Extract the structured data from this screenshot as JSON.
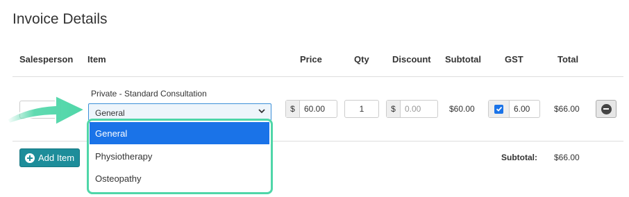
{
  "page": {
    "title": "Invoice Details"
  },
  "table": {
    "headers": {
      "salesperson": "Salesperson",
      "item": "Item",
      "price": "Price",
      "qty": "Qty",
      "discount": "Discount",
      "subtotal": "Subtotal",
      "gst": "GST",
      "total": "Total"
    },
    "row": {
      "item_name": "Private - Standard Consultation",
      "item_category": "General",
      "price_prefix": "$",
      "price": "60.00",
      "qty": "1",
      "discount_prefix": "$",
      "discount_placeholder": "0.00",
      "subtotal": "$60.00",
      "gst_checked": true,
      "gst": "6.00",
      "total": "$66.00"
    }
  },
  "dropdown": {
    "options": [
      "General",
      "Physiotherapy",
      "Osteopathy"
    ],
    "selected": "General"
  },
  "footer": {
    "add_item_label": "Add Item",
    "subtotal_label": "Subtotal:",
    "subtotal_value": "$66.00"
  },
  "colors": {
    "accent": "#1d8d9a",
    "highlight": "#4fd6a8",
    "selected": "#1a73e8"
  }
}
